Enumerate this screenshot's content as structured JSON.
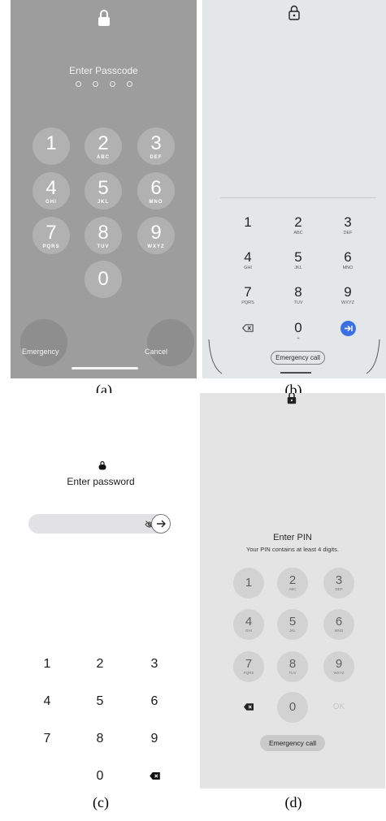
{
  "panel_a": {
    "title": "Enter Passcode",
    "keys": [
      {
        "digit": "1",
        "letters": ""
      },
      {
        "digit": "2",
        "letters": "ABC"
      },
      {
        "digit": "3",
        "letters": "DEF"
      },
      {
        "digit": "4",
        "letters": "GHI"
      },
      {
        "digit": "5",
        "letters": "JKL"
      },
      {
        "digit": "6",
        "letters": "MNO"
      },
      {
        "digit": "7",
        "letters": "PQRS"
      },
      {
        "digit": "8",
        "letters": "TUV"
      },
      {
        "digit": "9",
        "letters": "WXYZ"
      },
      {
        "digit": "0",
        "letters": ""
      }
    ],
    "emergency_label": "Emergency",
    "cancel_label": "Cancel",
    "caption": "(a)"
  },
  "panel_b": {
    "keys": [
      {
        "digit": "1",
        "letters": ""
      },
      {
        "digit": "2",
        "letters": "ABC"
      },
      {
        "digit": "3",
        "letters": "DEF"
      },
      {
        "digit": "4",
        "letters": "GHI"
      },
      {
        "digit": "5",
        "letters": "JKL"
      },
      {
        "digit": "6",
        "letters": "MNO"
      },
      {
        "digit": "7",
        "letters": "PQRS"
      },
      {
        "digit": "8",
        "letters": "TUV"
      },
      {
        "digit": "9",
        "letters": "WXYZ"
      },
      {
        "digit": "0",
        "letters": "+"
      }
    ],
    "emergency_label": "Emergency call",
    "accent_color": "#3a6fe6",
    "caption": "(b)"
  },
  "panel_c": {
    "title": "Enter password",
    "keys": [
      "1",
      "2",
      "3",
      "4",
      "5",
      "6",
      "7",
      "8",
      "9",
      "0"
    ],
    "caption": "(c)"
  },
  "panel_d": {
    "title": "Enter PIN",
    "subtitle": "Your PIN contains at least 4 digits.",
    "keys": [
      {
        "digit": "1",
        "letters": ""
      },
      {
        "digit": "2",
        "letters": "ABC"
      },
      {
        "digit": "3",
        "letters": "DEF"
      },
      {
        "digit": "4",
        "letters": "GHI"
      },
      {
        "digit": "5",
        "letters": "JKL"
      },
      {
        "digit": "6",
        "letters": "MNO"
      },
      {
        "digit": "7",
        "letters": "PQRS"
      },
      {
        "digit": "8",
        "letters": "TUV"
      },
      {
        "digit": "9",
        "letters": "WXYZ"
      },
      {
        "digit": "0",
        "letters": ""
      }
    ],
    "ok_label": "OK",
    "emergency_label": "Emergency call",
    "caption": "(d)"
  }
}
